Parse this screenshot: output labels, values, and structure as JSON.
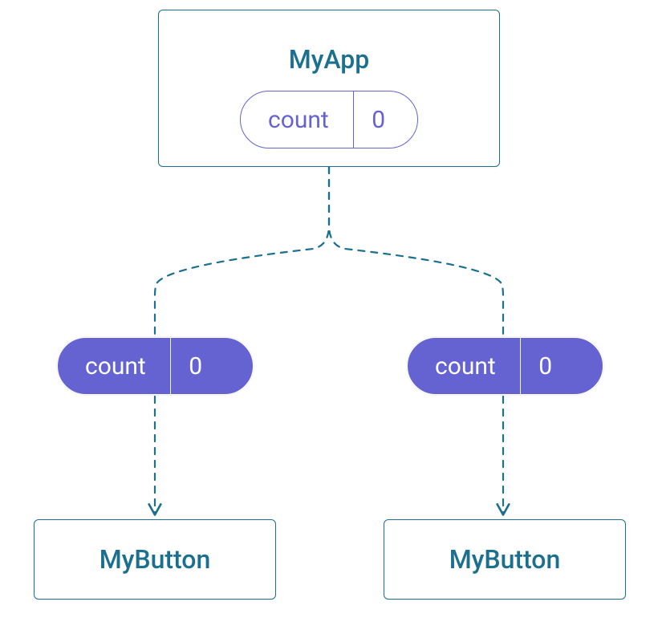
{
  "root": {
    "title": "MyApp",
    "state": {
      "label": "count",
      "value": "0"
    }
  },
  "children": [
    {
      "passedProp": {
        "label": "count",
        "value": "0"
      },
      "component": "MyButton"
    },
    {
      "passedProp": {
        "label": "count",
        "value": "0"
      },
      "component": "MyButton"
    }
  ],
  "colors": {
    "teal": "#1b6f8f",
    "purple": "#6563d1"
  }
}
